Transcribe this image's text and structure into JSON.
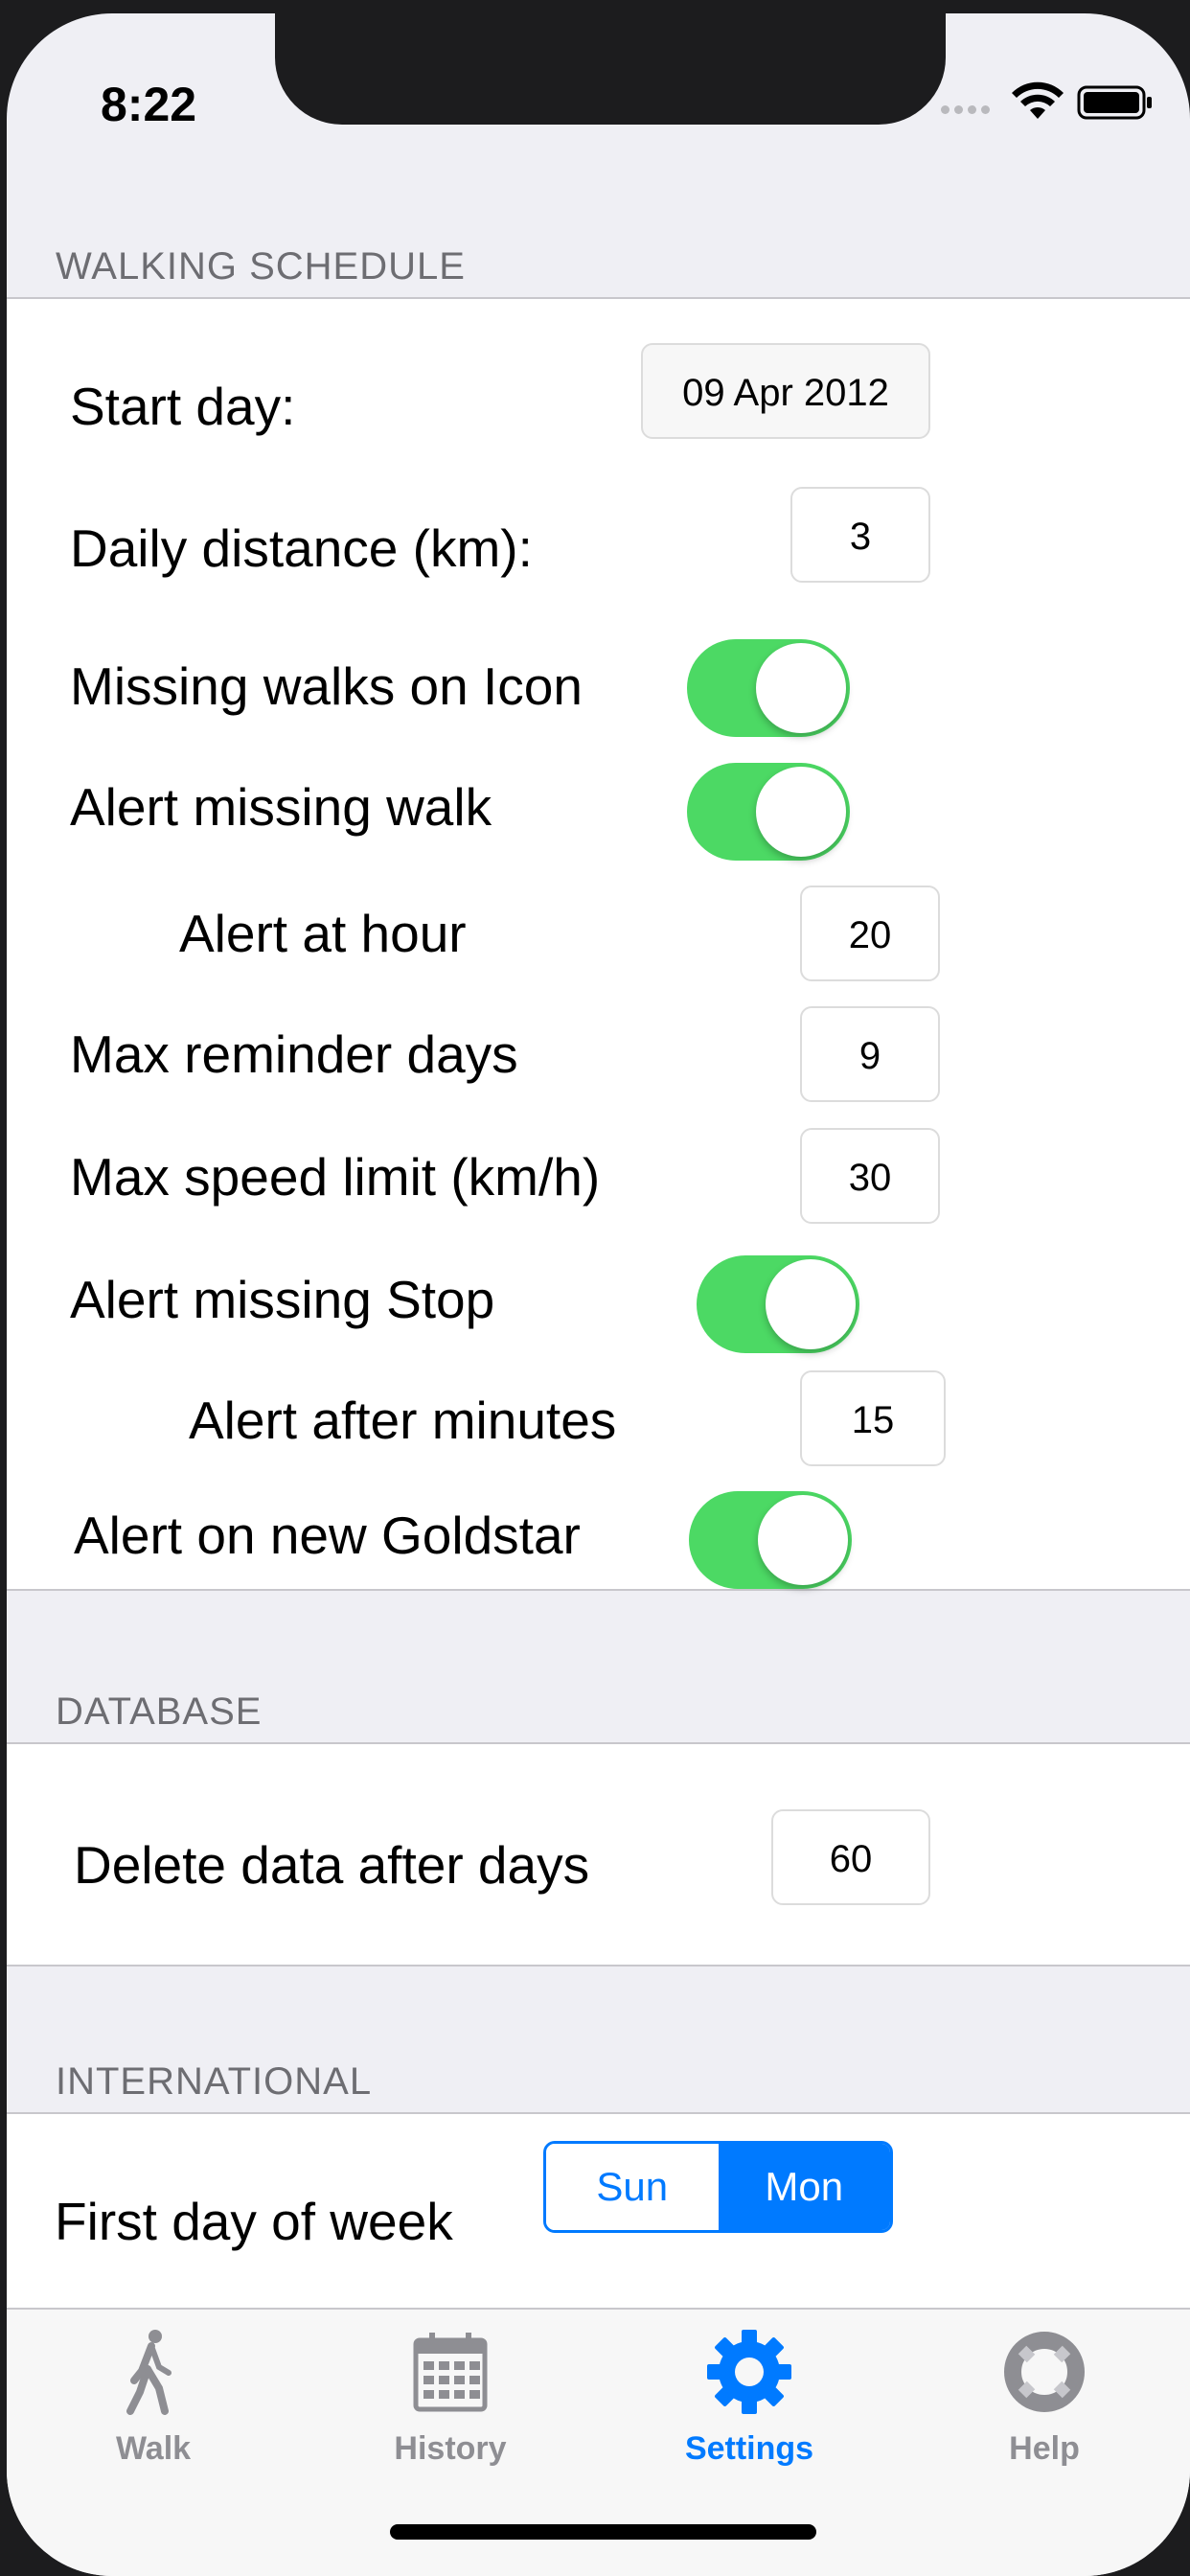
{
  "status_bar": {
    "time": "8:22"
  },
  "walking_schedule": {
    "header": "WALKING SCHEDULE",
    "start_day_label": "Start day:",
    "start_day_value": "09 Apr 2012",
    "daily_distance_label": "Daily distance (km):",
    "daily_distance_value": "3",
    "missing_walks_icon_label": "Missing walks on Icon",
    "missing_walks_icon_on": true,
    "alert_missing_walk_label": "Alert missing walk",
    "alert_missing_walk_on": true,
    "alert_at_hour_label": "Alert at hour",
    "alert_at_hour_value": "20",
    "max_reminder_days_label": "Max reminder days",
    "max_reminder_days_value": "9",
    "max_speed_limit_label": "Max speed limit (km/h)",
    "max_speed_limit_value": "30",
    "alert_missing_stop_label": "Alert missing Stop",
    "alert_missing_stop_on": true,
    "alert_after_minutes_label": "Alert after minutes",
    "alert_after_minutes_value": "15",
    "alert_new_goldstar_label": "Alert on new Goldstar",
    "alert_new_goldstar_on": true
  },
  "database": {
    "header": "DATABASE",
    "delete_after_days_label": "Delete data after days",
    "delete_after_days_value": "60"
  },
  "international": {
    "header": "INTERNATIONAL",
    "first_day_label": "First day of week",
    "options": [
      "Sun",
      "Mon"
    ],
    "selected": "Mon"
  },
  "tabbar": {
    "tabs": [
      {
        "label": "Walk",
        "icon": "walk-icon",
        "active": false
      },
      {
        "label": "History",
        "icon": "calendar-icon",
        "active": false
      },
      {
        "label": "Settings",
        "icon": "gear-icon",
        "active": true
      },
      {
        "label": "Help",
        "icon": "lifebuoy-icon",
        "active": false
      }
    ]
  },
  "colors": {
    "accent": "#007aff",
    "toggle_on": "#4cd964",
    "background": "#efeff4"
  }
}
